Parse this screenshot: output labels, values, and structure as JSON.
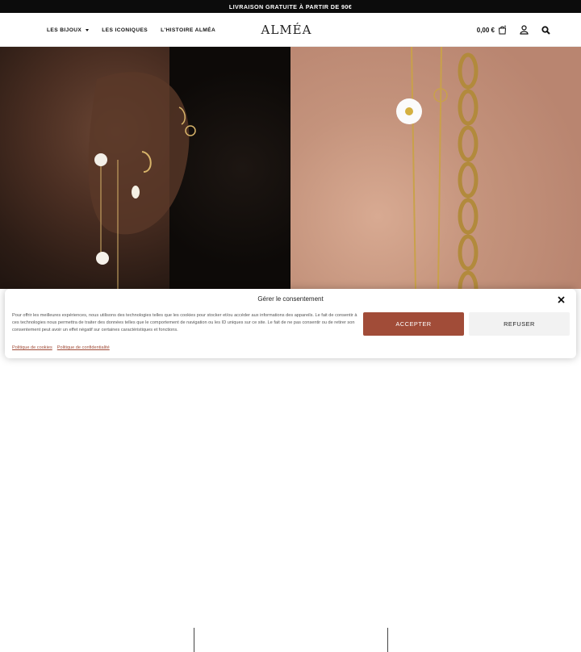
{
  "promo": {
    "text": "LIVRAISON GRATUITE À PARTIR DE 90€"
  },
  "header": {
    "nav": [
      {
        "label": "LES BIJOUX",
        "has_dropdown": true
      },
      {
        "label": "LES ICONIQUES"
      },
      {
        "label": "L'HISTOIRE ALMÉA"
      }
    ],
    "logo": "ALMÉA",
    "cart": {
      "amount": "0,00 €",
      "count": "0"
    },
    "icons": {
      "cart": "bag-icon",
      "account": "user-icon",
      "search": "search-icon"
    }
  },
  "hero": {
    "left_image": "earrings-on-ear-photo",
    "right_image": "bracelets-on-hand-photo"
  },
  "consent": {
    "title": "Gérer le consentement",
    "body": "Pour offrir les meilleures expériences, nous utilisons des technologies telles que les cookies pour stocker et/ou accéder aux informations des appareils. Le fait de consentir à ces technologies nous permettra de traiter des données telles que le comportement de navigation ou les ID uniques sur ce site. Le fait de ne pas consentir ou de retirer son consentement peut avoir un effet négatif sur certaines caractéristiques et fonctions.",
    "accept_label": "ACCEPTER",
    "refuse_label": "REFUSER",
    "links": [
      "Politique de cookies",
      "Politique de confidentialité"
    ]
  },
  "colors": {
    "accent": "#a14c38",
    "topbar": "#0c0c0c"
  }
}
